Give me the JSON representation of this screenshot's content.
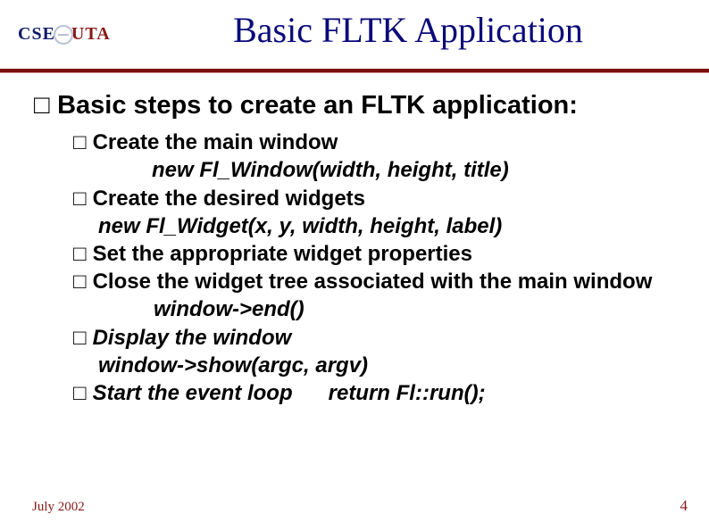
{
  "logo": {
    "left": "CSE",
    "right": "UTA"
  },
  "title": "Basic FLTK Application",
  "heading": "Basic steps to create an FLTK application:",
  "items": {
    "i1": "Create the main window",
    "i1a": "new Fl_Window(width, height, title)",
    "i2": "Create the desired widgets",
    "i2a": "new Fl_Widget(x, y, width, height, label)",
    "i3": "Set the appropriate widget properties",
    "i4": "Close the widget tree associated with the main window",
    "i4a": "window->end()",
    "i5": "Display the window",
    "i5a": "window->show(argc, argv)",
    "i6": "Start the event loop",
    "i6a": "return Fl::run();"
  },
  "footer": {
    "date": "July 2002",
    "page": "4"
  }
}
